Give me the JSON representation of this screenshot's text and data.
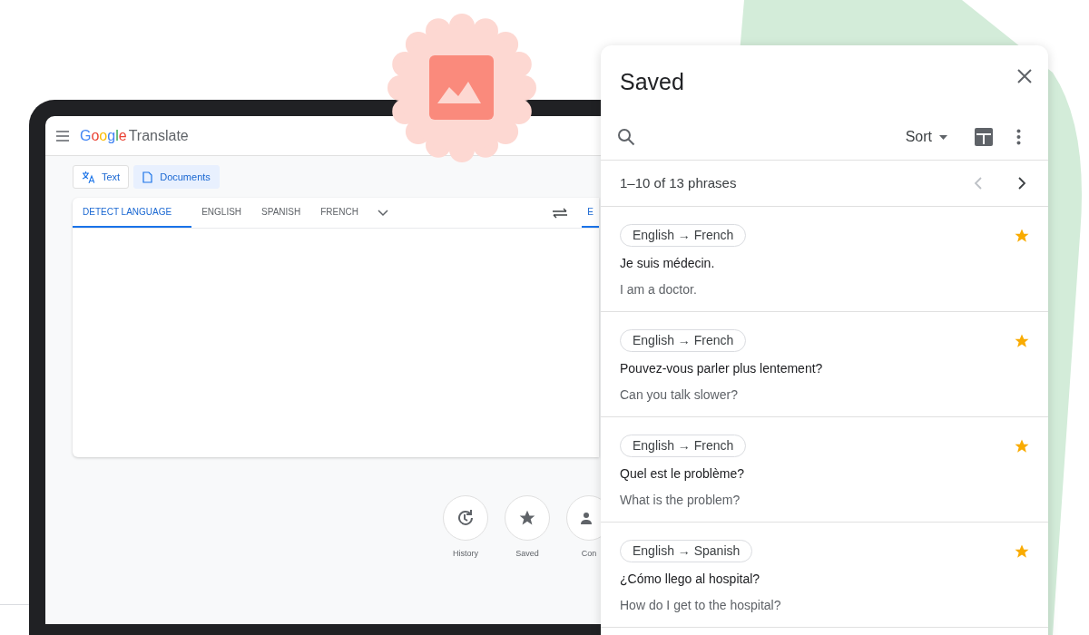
{
  "app": {
    "logo": "Google",
    "name": "Translate"
  },
  "mode_buttons": [
    {
      "kind": "text",
      "label": "Text",
      "selected": false
    },
    {
      "kind": "documents",
      "label": "Documents",
      "selected": true
    }
  ],
  "source_languages": [
    {
      "label": "DETECT LANGUAGE",
      "selected": true
    },
    {
      "label": "ENGLISH",
      "selected": false
    },
    {
      "label": "SPANISH",
      "selected": false
    },
    {
      "label": "FRENCH",
      "selected": false
    }
  ],
  "target_language": {
    "label": "E",
    "selected": true
  },
  "shortcuts": [
    {
      "kind": "history",
      "label": "History"
    },
    {
      "kind": "saved",
      "label": "Saved"
    },
    {
      "kind": "contribute",
      "label": "Con"
    }
  ],
  "saved_panel": {
    "title": "Saved",
    "sort": "Sort",
    "pagination": "1–10 of 13 phrases",
    "phrases": [
      {
        "languages": "English → French",
        "source": "Je suis médecin.",
        "translation": "I am a doctor.",
        "starred": true
      },
      {
        "languages": "English → French",
        "source": "Pouvez-vous parler plus lentement?",
        "translation": "Can you talk slower?",
        "starred": true
      },
      {
        "languages": "English → French",
        "source": "Quel est le problème?",
        "translation": "What is the problem?",
        "starred": true
      },
      {
        "languages": "English → Spanish",
        "source": "¿Cómo llego al hospital?",
        "translation": "How do I get to the hospital?",
        "starred": true
      }
    ]
  }
}
